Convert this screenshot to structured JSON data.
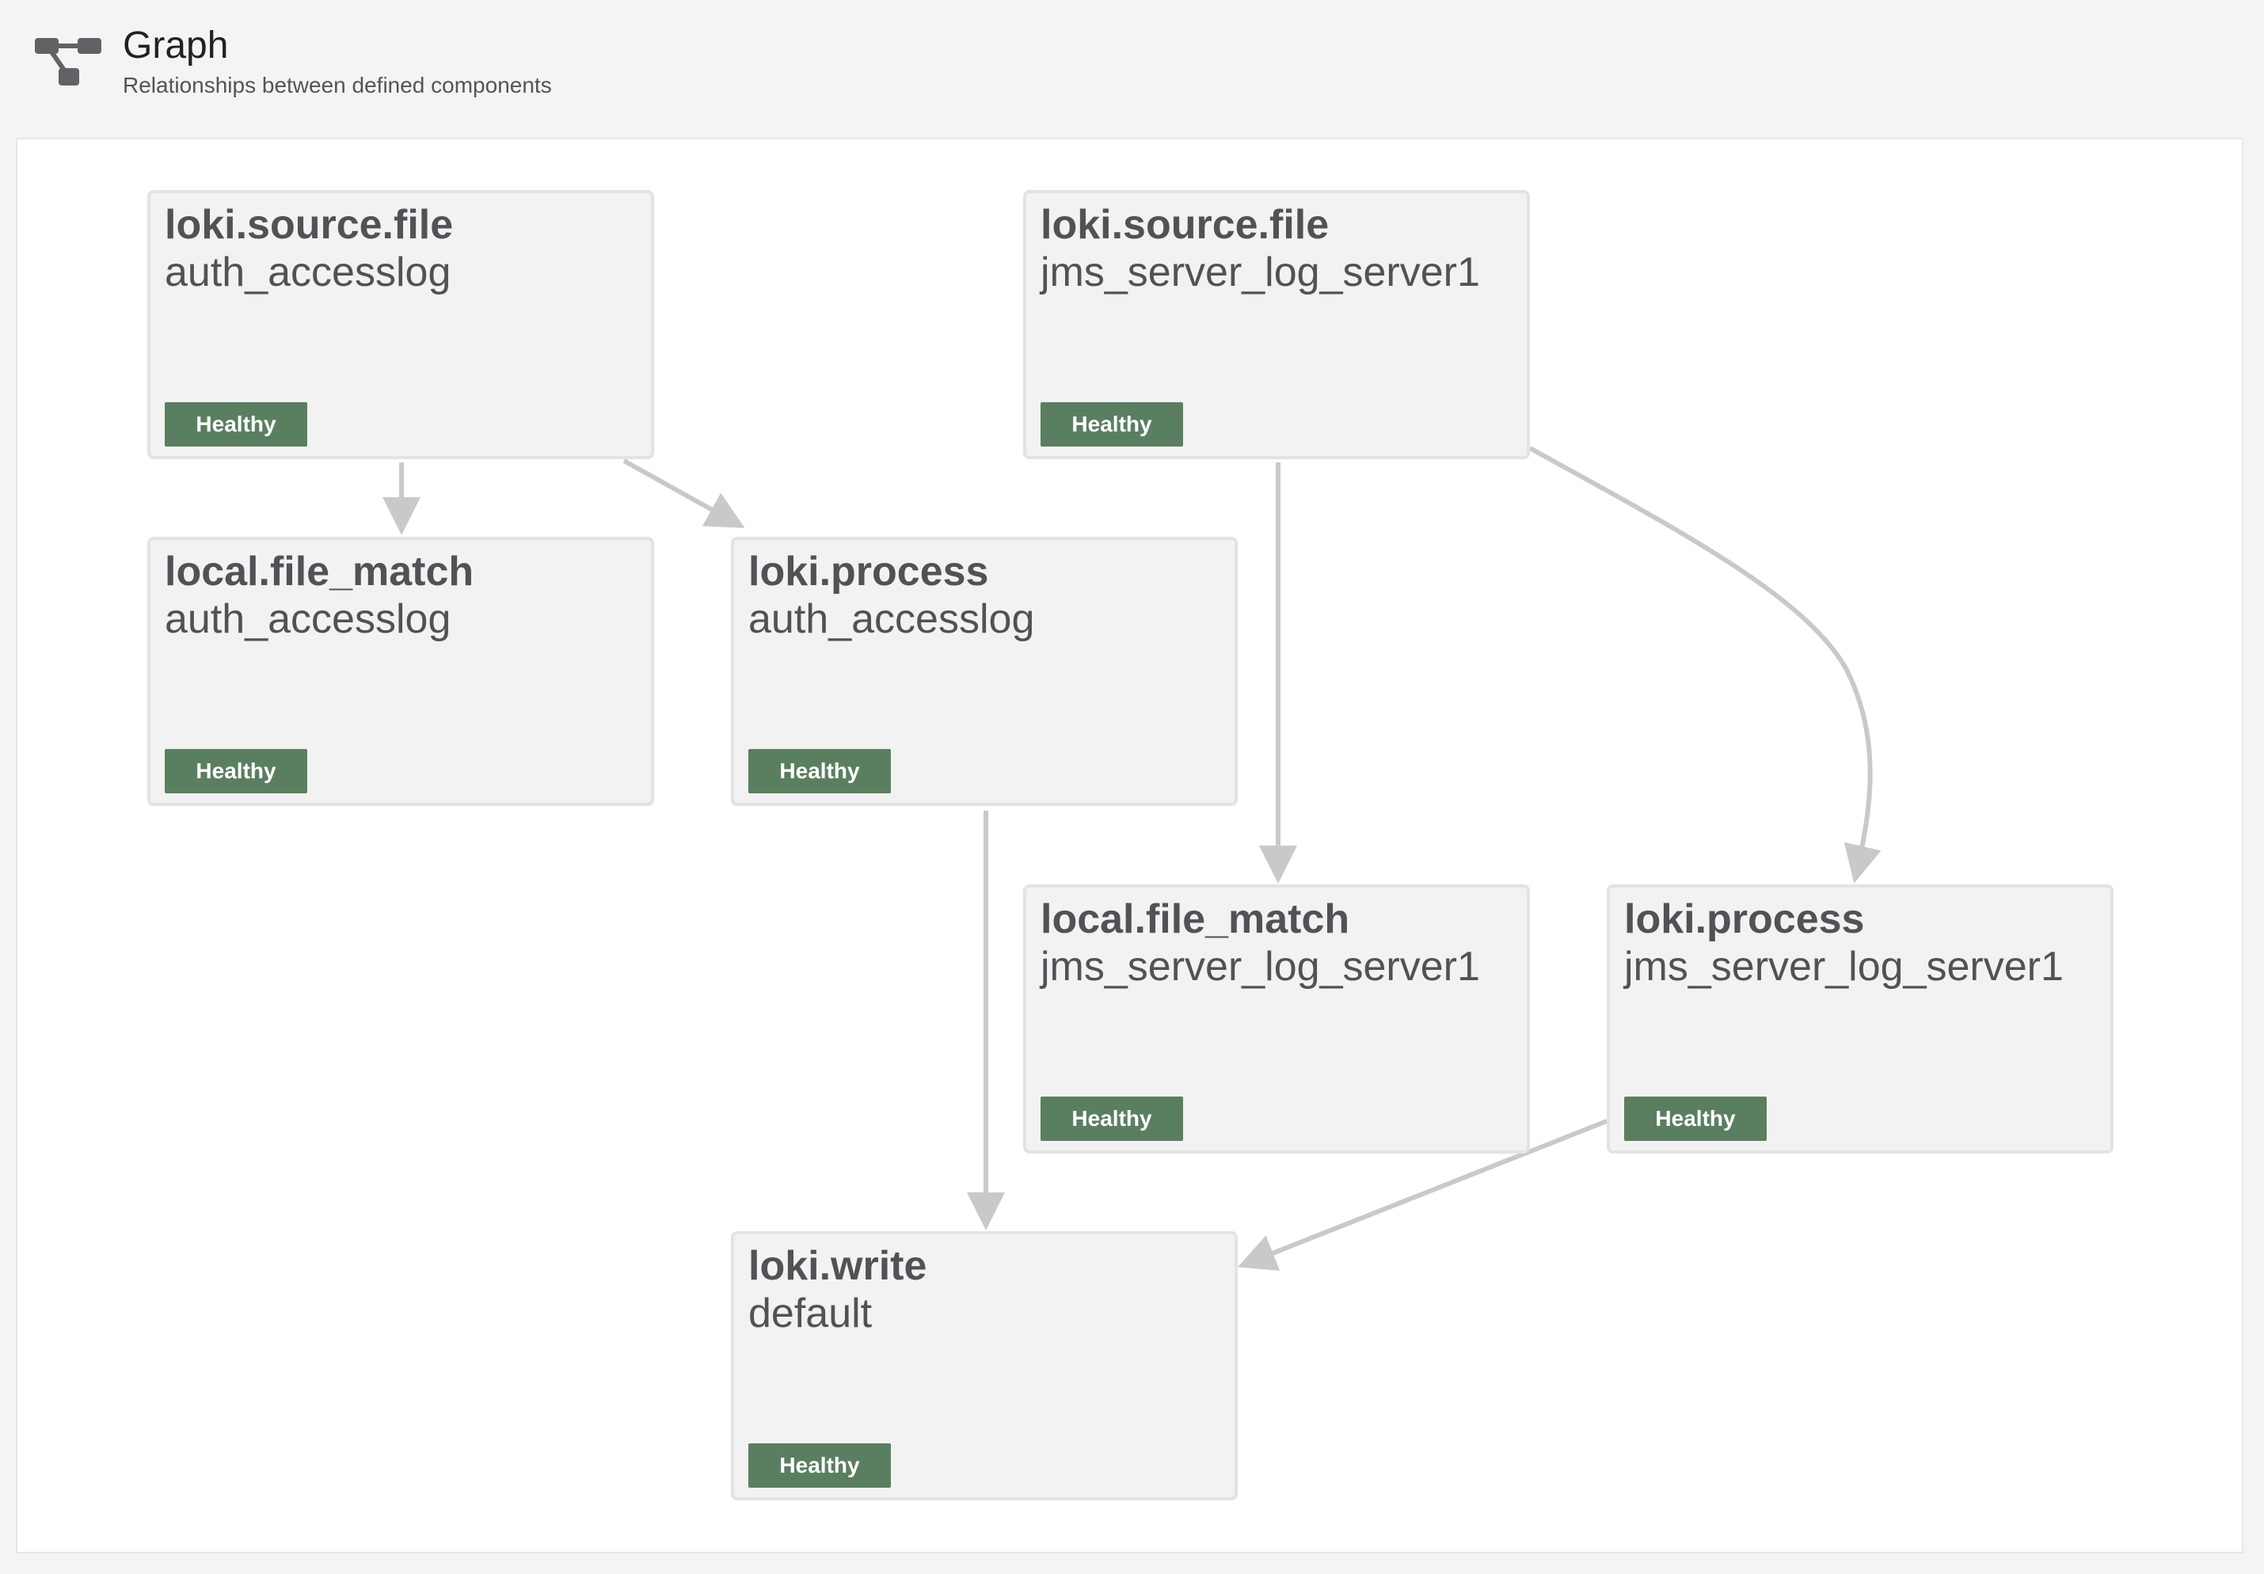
{
  "header": {
    "title": "Graph",
    "subtitle": "Relationships between defined components",
    "icon": "graph-icon"
  },
  "colors": {
    "badge_healthy": "#5a7f60",
    "node_background": "#f2f2f2",
    "edge": "#c9c9c9"
  },
  "nodes": [
    {
      "type": "loki.source.file",
      "label": "auth_accesslog",
      "health": "Healthy"
    },
    {
      "type": "loki.source.file",
      "label": "jms_server_log_server1",
      "health": "Healthy"
    },
    {
      "type": "local.file_match",
      "label": "auth_accesslog",
      "health": "Healthy"
    },
    {
      "type": "loki.process",
      "label": "auth_accesslog",
      "health": "Healthy"
    },
    {
      "type": "local.file_match",
      "label": "jms_server_log_server1",
      "health": "Healthy"
    },
    {
      "type": "loki.process",
      "label": "jms_server_log_server1",
      "health": "Healthy"
    },
    {
      "type": "loki.write",
      "label": "default",
      "health": "Healthy"
    }
  ]
}
